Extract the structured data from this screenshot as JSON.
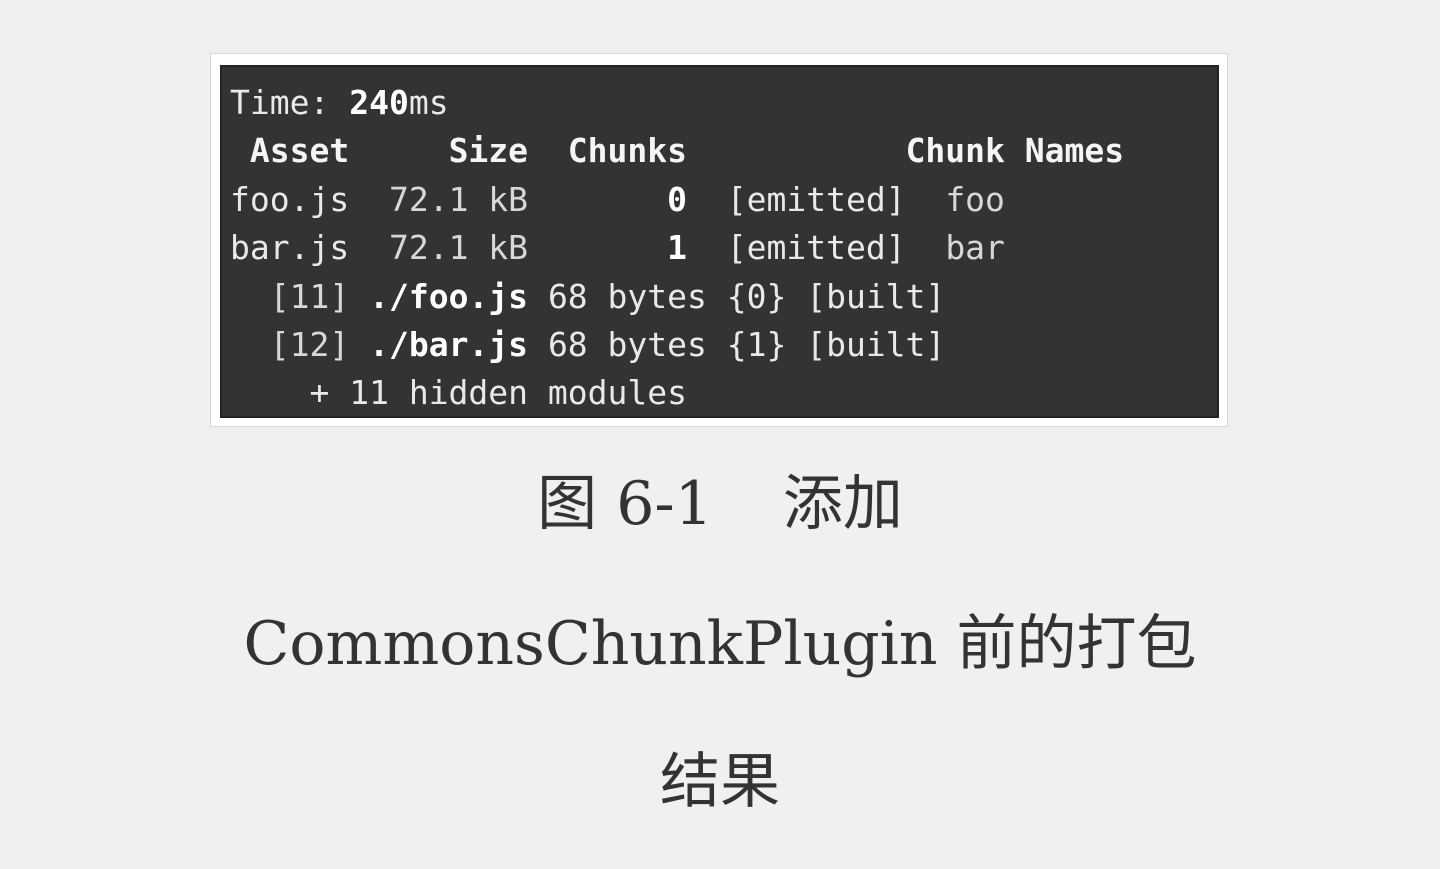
{
  "terminal": {
    "time_label": "Time: ",
    "time_value": "240",
    "time_unit": "ms",
    "header": {
      "asset": "Asset",
      "size": "Size",
      "chunks": "Chunks",
      "chunk_names": "Chunk Names"
    },
    "assets": [
      {
        "asset": "foo.js",
        "size": "72.1 kB",
        "chunk": "0",
        "status": "[emitted]",
        "name": "foo"
      },
      {
        "asset": "bar.js",
        "size": "72.1 kB",
        "chunk": "1",
        "status": "[emitted]",
        "name": "bar"
      }
    ],
    "modules": [
      {
        "id": "[11]",
        "path": "./foo.js",
        "info": "68 bytes {0} [built]"
      },
      {
        "id": "[12]",
        "path": "./bar.js",
        "info": "68 bytes {1} [built]"
      }
    ],
    "hidden_modules": "+ 11 hidden modules"
  },
  "caption": {
    "figure_number": "图 6-1",
    "title_part1": "添加",
    "title_part2": "CommonsChunkPlugin 前的打包",
    "title_part3": "结果"
  }
}
